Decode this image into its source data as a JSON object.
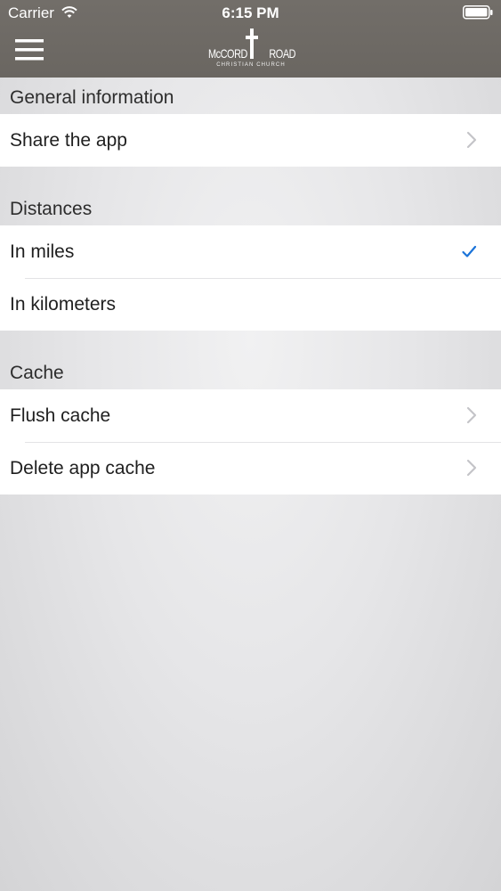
{
  "status_bar": {
    "carrier": "Carrier",
    "time": "6:15 PM",
    "icons": [
      "wifi-icon",
      "battery-icon"
    ]
  },
  "nav": {
    "menu_icon": "hamburger-menu-icon",
    "logo": {
      "word_left": "McCORD",
      "word_right": "ROAD",
      "subtitle": "CHRISTIAN CHURCH"
    }
  },
  "sections": [
    {
      "header": "General information",
      "rows": [
        {
          "label": "Share the app",
          "accessory": "chevron-right-icon"
        }
      ]
    },
    {
      "header": "Distances",
      "rows": [
        {
          "label": "In miles",
          "accessory": "checkmark-icon",
          "selected": true
        },
        {
          "label": "In kilometers",
          "accessory": "none",
          "selected": false
        }
      ]
    },
    {
      "header": "Cache",
      "rows": [
        {
          "label": "Flush cache",
          "accessory": "chevron-right-icon"
        },
        {
          "label": "Delete app cache",
          "accessory": "chevron-right-icon"
        }
      ]
    }
  ],
  "colors": {
    "nav_background": "#6c6863",
    "accent_checkmark": "#1a73d9",
    "chevron": "#c4c4c8",
    "section_header_text": "#2d2d2d"
  }
}
